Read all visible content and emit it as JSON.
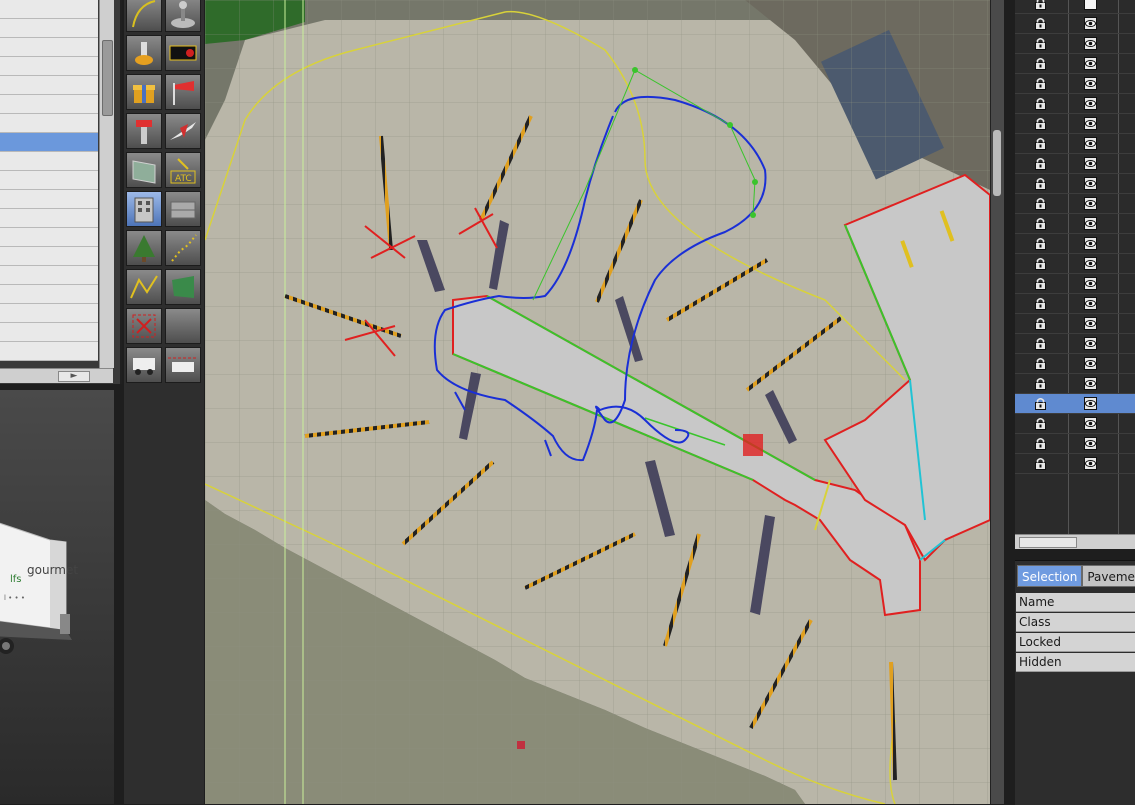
{
  "left_panel": {
    "selected_row": 7,
    "row_count": 19,
    "hscroll_glyph": "►"
  },
  "preview": {
    "asset_brand_text": "gourmet",
    "asset_brand_prefix": "lfs",
    "asset_small_text": "l • • •"
  },
  "tools": [
    {
      "name": "taxi-route-tool",
      "icon": "route-curve-icon"
    },
    {
      "name": "runway-sign-tool",
      "icon": "sign-post-icon"
    },
    {
      "name": "light-fixture-tool",
      "icon": "light-fixture-icon"
    },
    {
      "name": "taxi-sign-tool",
      "icon": "taxi-sign-icon",
      "label": "R4"
    },
    {
      "name": "object-tool",
      "icon": "gift-box-icon"
    },
    {
      "name": "windsock-tool",
      "icon": "windsock-icon"
    },
    {
      "name": "tower-tool",
      "icon": "control-tower-icon"
    },
    {
      "name": "airplane-start-tool",
      "icon": "airplane-icon"
    },
    {
      "name": "facade-tool",
      "icon": "facade-icon"
    },
    {
      "name": "atc-tool",
      "icon": "atc-icon",
      "label": "ATC"
    },
    {
      "name": "building-tool",
      "icon": "building-icon",
      "active": true
    },
    {
      "name": "draped-object-tool",
      "icon": "draped-object-icon"
    },
    {
      "name": "forest-tool",
      "icon": "tree-icon"
    },
    {
      "name": "line-tool",
      "icon": "dotted-line-icon"
    },
    {
      "name": "string-tool",
      "icon": "polyline-icon"
    },
    {
      "name": "polygon-tool",
      "icon": "polygon-icon"
    },
    {
      "name": "exclusion-tool",
      "icon": "exclusion-icon"
    },
    {
      "name": "empty-tool",
      "icon": "blank-icon"
    },
    {
      "name": "ground-vehicle-tool",
      "icon": "vehicle-icon"
    },
    {
      "name": "vehicle-route-tool",
      "icon": "vehicle-route-icon"
    }
  ],
  "layers": {
    "row_count": 24,
    "selected_row": 20,
    "first_row_box": true
  },
  "inspector": {
    "tabs": [
      {
        "label": "Selection",
        "active": true
      },
      {
        "label": "Pavemen",
        "active": false
      }
    ],
    "properties": [
      {
        "label": "Name"
      },
      {
        "label": "Class"
      },
      {
        "label": "Locked"
      },
      {
        "label": "Hidden"
      }
    ]
  },
  "colors": {
    "selection": "#6b98dc",
    "taxi_route": "#1a2fd6",
    "boundary": "#d8d23a",
    "lines_red": "#e02020",
    "lines_green": "#3ac42c"
  }
}
